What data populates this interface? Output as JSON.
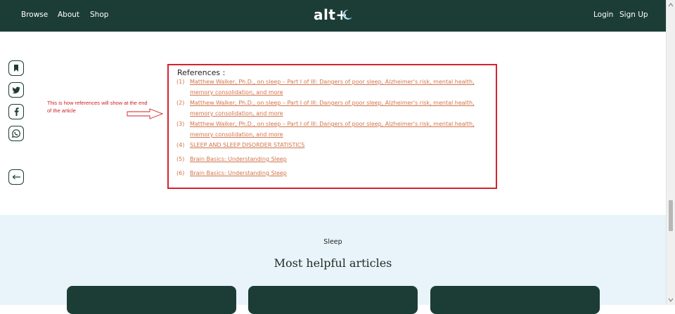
{
  "nav": {
    "links": [
      "Browse",
      "About",
      "Shop"
    ],
    "logo": "alt+",
    "login": "Login",
    "signup": "Sign Up"
  },
  "share_icons": [
    "bookmark-icon",
    "twitter-icon",
    "facebook-icon",
    "whatsapp-icon"
  ],
  "back_icon": "arrow-left-icon",
  "annotation": "This is how references will show at the end of the article",
  "references": {
    "title": "References :",
    "items": [
      {
        "num": "(1)",
        "text": "Matthew Walker, Ph.D., on sleep – Part I of III: Dangers of poor sleep, Alzheimer's risk, mental health, memory consolidation, and more"
      },
      {
        "num": "(2)",
        "text": "Matthew Walker, Ph.D., on sleep – Part I of III: Dangers of poor sleep, Alzheimer's risk, mental health, memory consolidation, and more"
      },
      {
        "num": "(3)",
        "text": "Matthew Walker, Ph.D., on sleep – Part I of III: Dangers of poor sleep, Alzheimer's risk, mental health, memory consolidation, and more"
      },
      {
        "num": "(4)",
        "text": "SLEEP AND SLEEP DISORDER STATISTICS"
      },
      {
        "num": "(5)",
        "text": "Brain Basics: Understanding Sleep"
      },
      {
        "num": "(6)",
        "text": "Brain Basics: Understanding Sleep"
      }
    ]
  },
  "articles": {
    "kicker": "Sleep",
    "heading": "Most helpful articles"
  },
  "colors": {
    "brand": "#1c3d35",
    "link": "#d2744a",
    "highlight": "#d4232d",
    "section_bg": "#e8f4fa"
  }
}
